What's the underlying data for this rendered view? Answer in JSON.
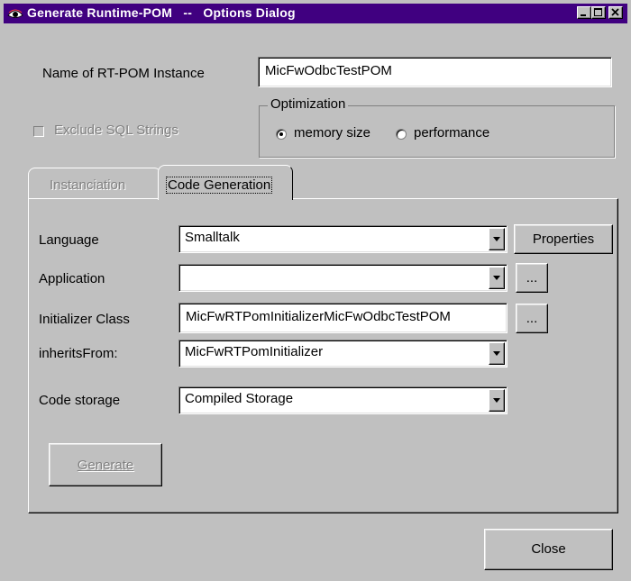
{
  "window": {
    "title": "Generate Runtime-POM   --   Options Dialog",
    "icon": "eye-icon",
    "controls": [
      "minimize-icon",
      "maximize-icon",
      "close-icon"
    ]
  },
  "instance": {
    "label": "Name of RT-POM Instance",
    "value": "MicFwOdbcTestPOM"
  },
  "exclude_sql": {
    "label": "Exclude SQL Strings",
    "checked": false,
    "enabled": false
  },
  "optimization": {
    "legend": "Optimization",
    "options": [
      {
        "label": "memory size",
        "selected": true
      },
      {
        "label": "performance",
        "selected": false
      }
    ]
  },
  "tabs": [
    {
      "label": "Instanciation",
      "active": false,
      "enabled": false
    },
    {
      "label": "Code Generation",
      "active": true,
      "enabled": true
    }
  ],
  "code_generation": {
    "language": {
      "label": "Language",
      "value": "Smalltalk",
      "button": "Properties"
    },
    "application": {
      "label": "Application",
      "value": "",
      "button": "..."
    },
    "initializer": {
      "label": "Initializer Class",
      "value": "MicFwRTPomInitializerMicFwOdbcTestPOM",
      "button": "..."
    },
    "inherits": {
      "label": "inheritsFrom:",
      "value": "MicFwRTPomInitializer"
    },
    "storage": {
      "label": "Code storage",
      "value": "Compiled Storage"
    },
    "generate": {
      "label": "Generate",
      "enabled": false
    }
  },
  "close_button": {
    "label": "Close"
  },
  "colors": {
    "titlebar": "#400080",
    "face": "#c0c0c0"
  }
}
